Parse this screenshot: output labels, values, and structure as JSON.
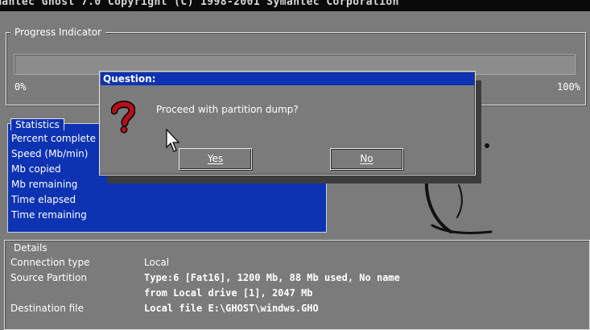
{
  "app": {
    "title": "mantec Ghost 7.0   Copyright (C) 1998-2001 Symantec Corporation"
  },
  "progress": {
    "label": "Progress Indicator",
    "start_label": "0%",
    "end_label": "100%",
    "value_percent": 0
  },
  "statistics": {
    "label": "Statistics",
    "rows": [
      "Percent complete",
      "Speed (Mb/min)",
      "Mb copied",
      "Mb remaining",
      "Time elapsed",
      "Time remaining"
    ]
  },
  "details": {
    "label": "Details",
    "connection_type_label": "Connection type",
    "connection_type_value": "Local",
    "source_partition_label": "Source Partition",
    "source_partition_line1": "Type:6 [Fat16], 1200 Mb, 88 Mb used, No name",
    "source_partition_line2": "from Local drive [1], 2047 Mb",
    "destination_file_label": "Destination file",
    "destination_file_value": "Local file E:\\GHOST\\windws.GHO"
  },
  "dialog": {
    "title": "Question:",
    "message": "Proceed with partition dump?",
    "yes_label": "Yes",
    "no_label": "No"
  },
  "colors": {
    "background": "#7b7b7b",
    "accent_blue": "#0d33b3",
    "text": "#ffffff"
  },
  "icons": {
    "dialog_icon": "question-mark-icon",
    "pointer": "mouse-cursor-icon"
  }
}
